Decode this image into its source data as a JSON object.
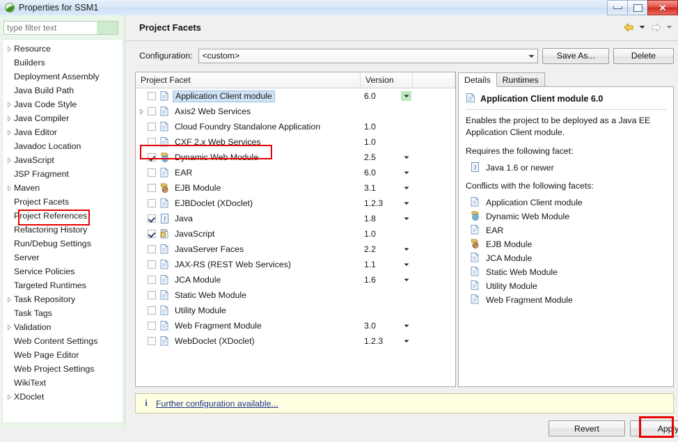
{
  "window": {
    "title": "Properties for SSM1",
    "app_icon": "eclipse-icon",
    "controls": [
      {
        "name": "minimize-button",
        "glyph": "minimize-icon"
      },
      {
        "name": "maximize-button",
        "glyph": "maximize-icon"
      },
      {
        "name": "close-button",
        "glyph": "close-icon",
        "color": "#cf2b21"
      }
    ]
  },
  "sidebar": {
    "filter": {
      "placeholder": "type filter text",
      "value": ""
    },
    "selected": "Project Facets",
    "items": [
      {
        "label": "Resource",
        "expandable": true
      },
      {
        "label": "Builders",
        "expandable": false
      },
      {
        "label": "Deployment Assembly",
        "expandable": false
      },
      {
        "label": "Java Build Path",
        "expandable": false
      },
      {
        "label": "Java Code Style",
        "expandable": true
      },
      {
        "label": "Java Compiler",
        "expandable": true
      },
      {
        "label": "Java Editor",
        "expandable": true
      },
      {
        "label": "Javadoc Location",
        "expandable": false
      },
      {
        "label": "JavaScript",
        "expandable": true
      },
      {
        "label": "JSP Fragment",
        "expandable": false
      },
      {
        "label": "Maven",
        "expandable": true
      },
      {
        "label": "Project Facets",
        "expandable": false
      },
      {
        "label": "Project References",
        "expandable": false
      },
      {
        "label": "Refactoring History",
        "expandable": false
      },
      {
        "label": "Run/Debug Settings",
        "expandable": false
      },
      {
        "label": "Server",
        "expandable": false
      },
      {
        "label": "Service Policies",
        "expandable": false
      },
      {
        "label": "Targeted Runtimes",
        "expandable": false
      },
      {
        "label": "Task Repository",
        "expandable": true
      },
      {
        "label": "Task Tags",
        "expandable": false
      },
      {
        "label": "Validation",
        "expandable": true
      },
      {
        "label": "Web Content Settings",
        "expandable": false
      },
      {
        "label": "Web Page Editor",
        "expandable": false
      },
      {
        "label": "Web Project Settings",
        "expandable": false
      },
      {
        "label": "WikiText",
        "expandable": false
      },
      {
        "label": "XDoclet",
        "expandable": true
      }
    ]
  },
  "page": {
    "title": "Project Facets",
    "nav": {
      "back_icon": "back-arrow-icon",
      "forward_icon": "forward-arrow-icon",
      "chevron_icon": "chevron-down-icon"
    },
    "configuration": {
      "label": "Configuration:",
      "value": "<custom>",
      "save_as_label": "Save As...",
      "delete_label": "Delete"
    },
    "table": {
      "columns": [
        "Project Facet",
        "Version"
      ],
      "rows": [
        {
          "name": "Application Client module",
          "version": "6.0",
          "checked": false,
          "expandable": false,
          "icon": "doc-icon",
          "selected": true,
          "dropdown": true,
          "dropdown_highlight": true
        },
        {
          "name": "Axis2 Web Services",
          "version": "",
          "checked": false,
          "expandable": true,
          "icon": "doc-icon",
          "selected": false,
          "dropdown": false,
          "dropdown_highlight": false
        },
        {
          "name": "Cloud Foundry Standalone Application",
          "version": "1.0",
          "checked": false,
          "expandable": false,
          "icon": "doc-icon",
          "selected": false,
          "dropdown": false,
          "dropdown_highlight": false
        },
        {
          "name": "CXF 2.x Web Services",
          "version": "1.0",
          "checked": false,
          "expandable": false,
          "icon": "doc-icon",
          "selected": false,
          "dropdown": false,
          "dropdown_highlight": false
        },
        {
          "name": "Dynamic Web Module",
          "version": "2.5",
          "checked": true,
          "expandable": false,
          "icon": "web-module-icon",
          "selected": false,
          "dropdown": true,
          "dropdown_highlight": false
        },
        {
          "name": "EAR",
          "version": "6.0",
          "checked": false,
          "expandable": false,
          "icon": "doc-icon",
          "selected": false,
          "dropdown": true,
          "dropdown_highlight": false
        },
        {
          "name": "EJB Module",
          "version": "3.1",
          "checked": false,
          "expandable": false,
          "icon": "ejb-icon",
          "selected": false,
          "dropdown": true,
          "dropdown_highlight": false
        },
        {
          "name": "EJBDoclet (XDoclet)",
          "version": "1.2.3",
          "checked": false,
          "expandable": false,
          "icon": "doc-icon",
          "selected": false,
          "dropdown": true,
          "dropdown_highlight": false
        },
        {
          "name": "Java",
          "version": "1.8",
          "checked": true,
          "expandable": false,
          "icon": "java-icon",
          "selected": false,
          "dropdown": true,
          "dropdown_highlight": false
        },
        {
          "name": "JavaScript",
          "version": "1.0",
          "checked": true,
          "expandable": false,
          "icon": "javascript-icon",
          "selected": false,
          "dropdown": false,
          "dropdown_highlight": false
        },
        {
          "name": "JavaServer Faces",
          "version": "2.2",
          "checked": false,
          "expandable": false,
          "icon": "doc-icon",
          "selected": false,
          "dropdown": true,
          "dropdown_highlight": false
        },
        {
          "name": "JAX-RS (REST Web Services)",
          "version": "1.1",
          "checked": false,
          "expandable": false,
          "icon": "doc-icon",
          "selected": false,
          "dropdown": true,
          "dropdown_highlight": false
        },
        {
          "name": "JCA Module",
          "version": "1.6",
          "checked": false,
          "expandable": false,
          "icon": "doc-icon",
          "selected": false,
          "dropdown": true,
          "dropdown_highlight": false
        },
        {
          "name": "Static Web Module",
          "version": "",
          "checked": false,
          "expandable": false,
          "icon": "doc-icon",
          "selected": false,
          "dropdown": false,
          "dropdown_highlight": false
        },
        {
          "name": "Utility Module",
          "version": "",
          "checked": false,
          "expandable": false,
          "icon": "doc-icon",
          "selected": false,
          "dropdown": false,
          "dropdown_highlight": false
        },
        {
          "name": "Web Fragment Module",
          "version": "3.0",
          "checked": false,
          "expandable": false,
          "icon": "doc-icon",
          "selected": false,
          "dropdown": true,
          "dropdown_highlight": false
        },
        {
          "name": "WebDoclet (XDoclet)",
          "version": "1.2.3",
          "checked": false,
          "expandable": false,
          "icon": "doc-icon",
          "selected": false,
          "dropdown": true,
          "dropdown_highlight": false
        }
      ]
    },
    "details": {
      "tabs": [
        {
          "label": "Details",
          "active": true
        },
        {
          "label": "Runtimes",
          "active": false
        }
      ],
      "heading": "Application Client module 6.0",
      "heading_icon": "doc-icon",
      "description": "Enables the project to be deployed as a Java EE Application Client module.",
      "requires_label": "Requires the following facet:",
      "requires": [
        {
          "label": "Java 1.6 or newer",
          "icon": "java-icon"
        }
      ],
      "conflicts_label": "Conflicts with the following facets:",
      "conflicts": [
        {
          "label": "Application Client module",
          "icon": "doc-icon"
        },
        {
          "label": "Dynamic Web Module",
          "icon": "web-module-icon"
        },
        {
          "label": "EAR",
          "icon": "doc-icon"
        },
        {
          "label": "EJB Module",
          "icon": "ejb-icon"
        },
        {
          "label": "JCA Module",
          "icon": "doc-icon"
        },
        {
          "label": "Static Web Module",
          "icon": "doc-icon"
        },
        {
          "label": "Utility Module",
          "icon": "doc-icon"
        },
        {
          "label": "Web Fragment Module",
          "icon": "doc-icon"
        }
      ]
    },
    "info": {
      "icon": "info-icon",
      "link": "Further configuration available..."
    },
    "buttons": {
      "revert": "Revert",
      "apply": "Apply"
    }
  },
  "annotations": {
    "highlight_color": "#e60000",
    "boxes": [
      "Project Facets sidebar item",
      "Dynamic Web Module row",
      "Apply button"
    ]
  }
}
